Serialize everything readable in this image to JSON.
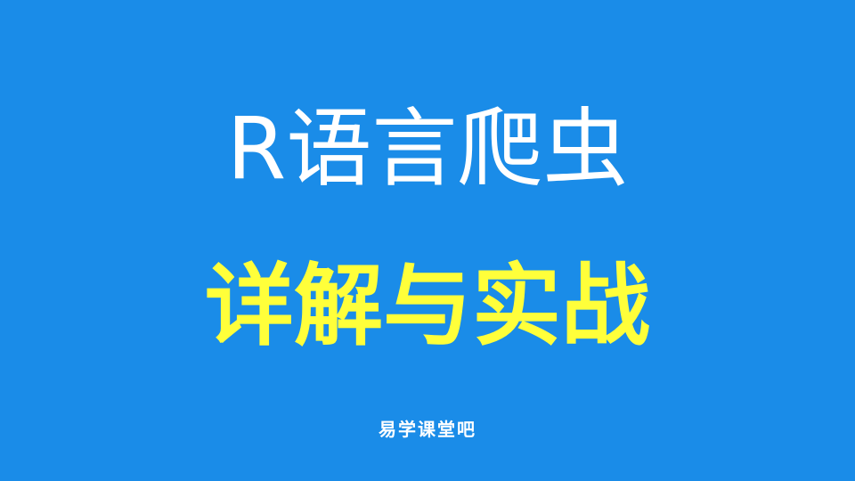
{
  "cover": {
    "title_main": "R语言爬虫",
    "title_sub": "详解与实战",
    "brand": "易学课堂吧",
    "colors": {
      "background": "#1a8ce8",
      "title_main": "#ffffff",
      "title_sub": "#ffff3a",
      "brand": "#ffffff"
    }
  }
}
